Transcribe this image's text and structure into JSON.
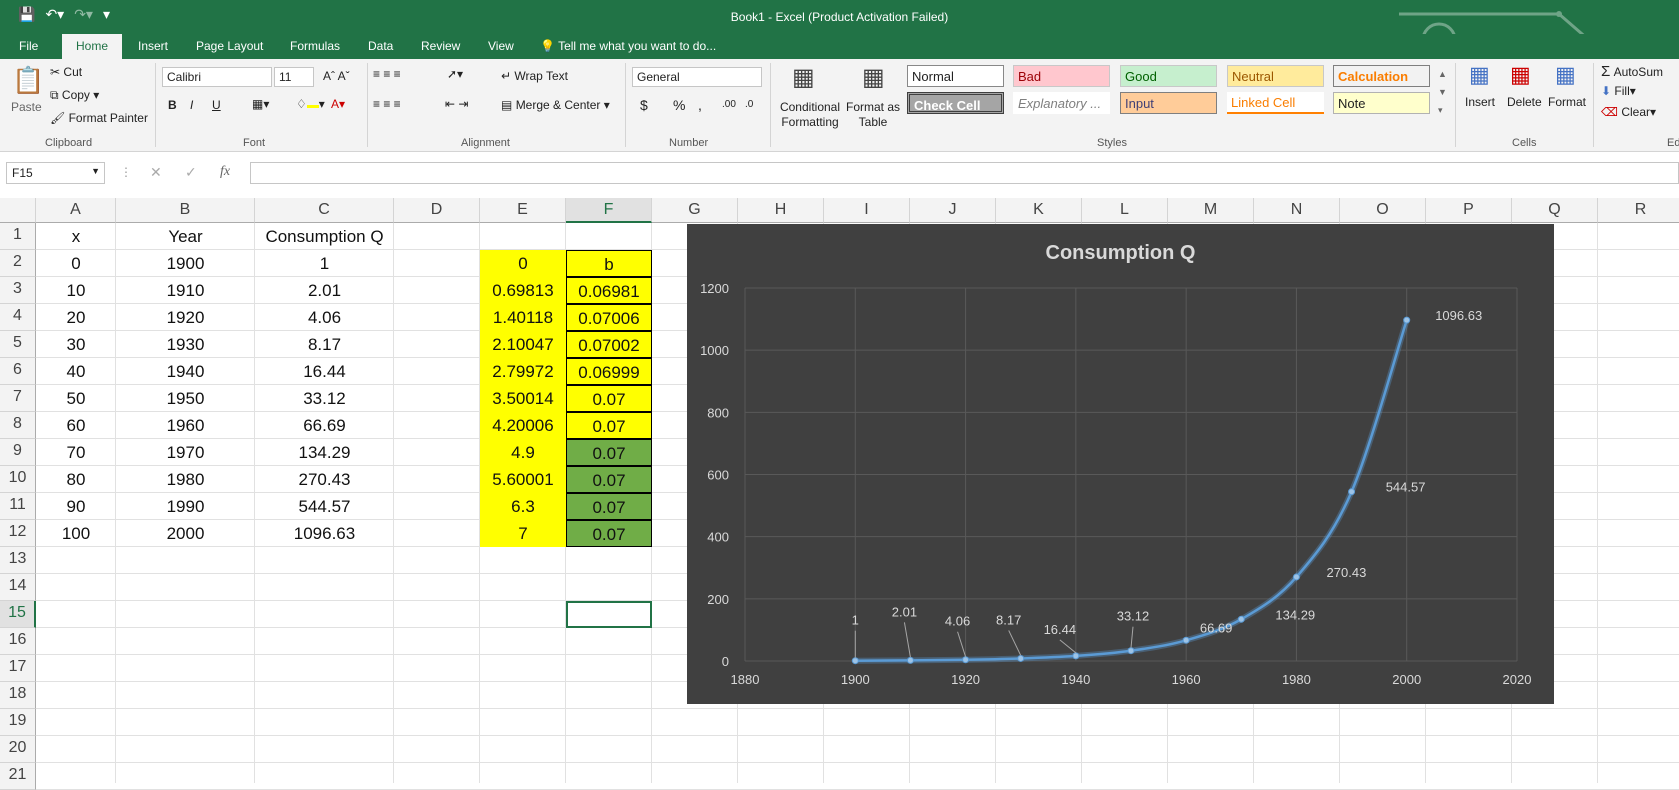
{
  "window": {
    "title": "Book1 - Excel (Product Activation Failed)"
  },
  "tabs": [
    "File",
    "Home",
    "Insert",
    "Page Layout",
    "Formulas",
    "Data",
    "Review",
    "View"
  ],
  "tell_me": "Tell me what you want to do...",
  "ribbon": {
    "clipboard": {
      "paste": "Paste",
      "cut": "Cut",
      "copy": "Copy",
      "format_painter": "Format Painter",
      "label": "Clipboard"
    },
    "font": {
      "name": "Calibri",
      "size": "11",
      "label": "Font",
      "bold": "B",
      "italic": "I",
      "underline": "U"
    },
    "alignment": {
      "wrap_text": "Wrap Text",
      "merge_center": "Merge & Center",
      "label": "Alignment"
    },
    "number": {
      "format": "General",
      "label": "Number",
      "currency": "$",
      "percent": "%",
      "comma": ",",
      "inc_decimal": ".00",
      "dec_decimal": ".0"
    },
    "styles": {
      "conditional": "Conditional Formatting",
      "format_as_table": "Format as Table",
      "cells": [
        "Normal",
        "Bad",
        "Good",
        "Neutral",
        "Calculation",
        "Check Cell",
        "Explanatory ...",
        "Input",
        "Linked Cell",
        "Note"
      ],
      "label": "Styles"
    },
    "cells": {
      "insert": "Insert",
      "delete": "Delete",
      "format": "Format",
      "label": "Cells"
    },
    "editing": {
      "autosum": "AutoSum",
      "fill": "Fill",
      "clear": "Clear",
      "label": "Ed"
    }
  },
  "name_box": "F15",
  "fx": "fx",
  "columns": [
    "A",
    "B",
    "C",
    "D",
    "E",
    "F",
    "G",
    "H",
    "I",
    "J",
    "K",
    "L",
    "M",
    "N",
    "O",
    "P",
    "Q",
    "R"
  ],
  "rows": [
    "1",
    "2",
    "3",
    "4",
    "5",
    "6",
    "7",
    "8",
    "9",
    "10",
    "11",
    "12",
    "13",
    "14",
    "15",
    "16",
    "17",
    "18",
    "19",
    "20",
    "21"
  ],
  "sheet": {
    "headers": {
      "A": "x",
      "B": "Year",
      "C": "Consumption Q"
    },
    "A": [
      "0",
      "10",
      "20",
      "30",
      "40",
      "50",
      "60",
      "70",
      "80",
      "90",
      "100"
    ],
    "B": [
      "1900",
      "1910",
      "1920",
      "1930",
      "1940",
      "1950",
      "1960",
      "1970",
      "1980",
      "1990",
      "2000"
    ],
    "C": [
      "1",
      "2.01",
      "4.06",
      "8.17",
      "16.44",
      "33.12",
      "66.69",
      "134.29",
      "270.43",
      "544.57",
      "1096.63"
    ],
    "E": [
      "0",
      "0.69813",
      "1.40118",
      "2.10047",
      "2.79972",
      "3.50014",
      "4.20006",
      "4.9",
      "5.60001",
      "6.3",
      "7"
    ],
    "F": [
      "b",
      "0.06981",
      "0.07006",
      "0.07002",
      "0.06999",
      "0.07",
      "0.07",
      "0.07",
      "0.07",
      "0.07",
      "0.07"
    ]
  },
  "chart_data": {
    "type": "scatter",
    "title": "Consumption Q",
    "x": [
      1900,
      1910,
      1920,
      1930,
      1940,
      1950,
      1960,
      1970,
      1980,
      1990,
      2000
    ],
    "y": [
      1,
      2.01,
      4.06,
      8.17,
      16.44,
      33.12,
      66.69,
      134.29,
      270.43,
      544.57,
      1096.63
    ],
    "labels": [
      "1",
      "2.01",
      "4.06",
      "8.17",
      "16.44",
      "33.12",
      "66.69",
      "134.29",
      "270.43",
      "544.57",
      "1096.63"
    ],
    "xlim": [
      1880,
      2020
    ],
    "ylim": [
      0,
      1200
    ],
    "xticks": [
      "1880",
      "1900",
      "1920",
      "1940",
      "1960",
      "1980",
      "2000",
      "2020"
    ],
    "yticks": [
      "0",
      "200",
      "400",
      "600",
      "800",
      "1000",
      "1200"
    ],
    "grid": true,
    "line_color": "#5b9bd5",
    "background": "#404040"
  }
}
